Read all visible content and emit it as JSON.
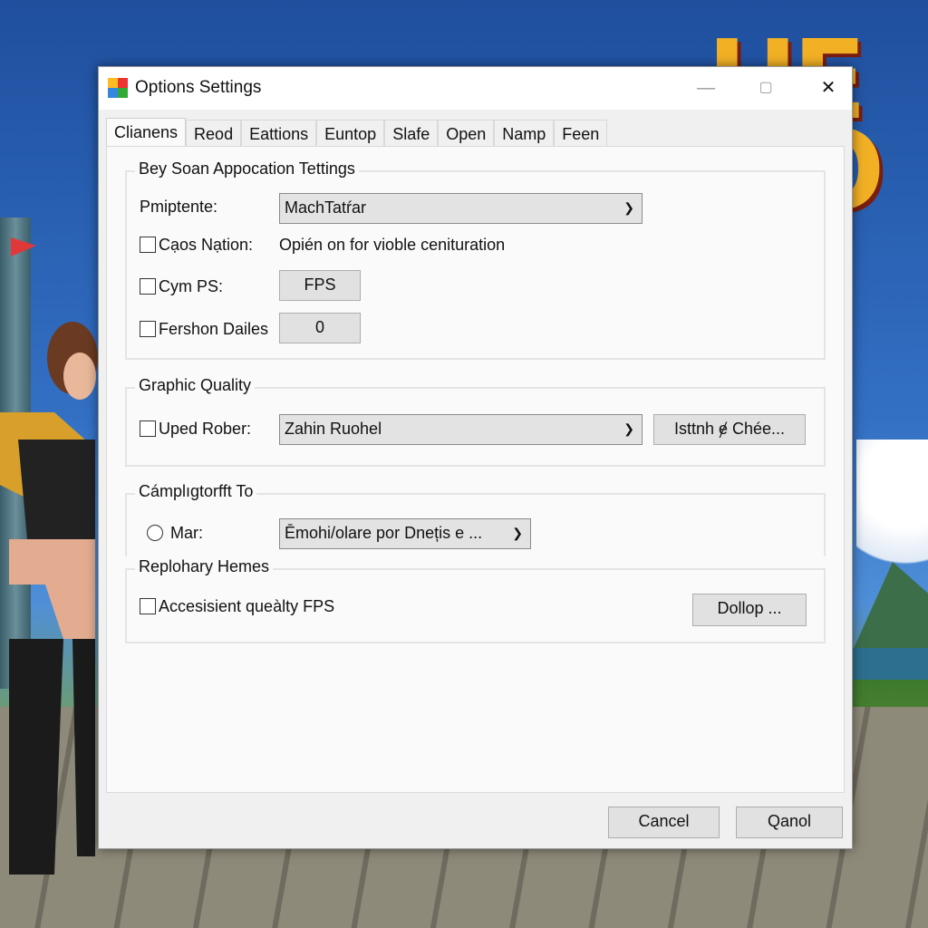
{
  "background": {
    "logo_text": "HEI\nHO"
  },
  "dialog": {
    "title": "Options Settings",
    "window_controls": {
      "minimize": "—",
      "maximize": "▢",
      "close": "✕"
    },
    "tabs": [
      {
        "label": "Clianens",
        "active": true
      },
      {
        "label": "Reod"
      },
      {
        "label": "Eattions"
      },
      {
        "label": "Euntop"
      },
      {
        "label": "Slafe"
      },
      {
        "label": "Open"
      },
      {
        "label": "Namp"
      },
      {
        "label": "Feen"
      }
    ],
    "group1": {
      "title": "Bey Soan Appocation Tettings",
      "row1": {
        "label": "Pmiptente:",
        "select_value": "MachTatŕar"
      },
      "row2": {
        "label": "Cạos Nạtion:",
        "checked": false,
        "text": "Opién on for vioble cenituration"
      },
      "row3": {
        "label": "Cym PS:",
        "checked": false,
        "button": "FPS"
      },
      "row4": {
        "label": "Fershon Dailes",
        "checked": false,
        "value": "0"
      }
    },
    "group2": {
      "title": "Graphic Quality",
      "label": "Uped Rober:",
      "checked": false,
      "select_value": "Zahin Ruohel",
      "button": "Isttnh ɇ Chée..."
    },
    "group3": {
      "title": "Cámplıgtorfft To",
      "label": "Mar:",
      "radio_selected": false,
      "select_value": "Ēmohi/olare por Dnețis e ..."
    },
    "group4": {
      "title": "Replohary Hemes",
      "label": "Accesisient queàlty FPS",
      "checked": false,
      "button": "Dollop ..."
    },
    "footer": {
      "cancel": "Cancel",
      "ok": "Qanol"
    }
  }
}
